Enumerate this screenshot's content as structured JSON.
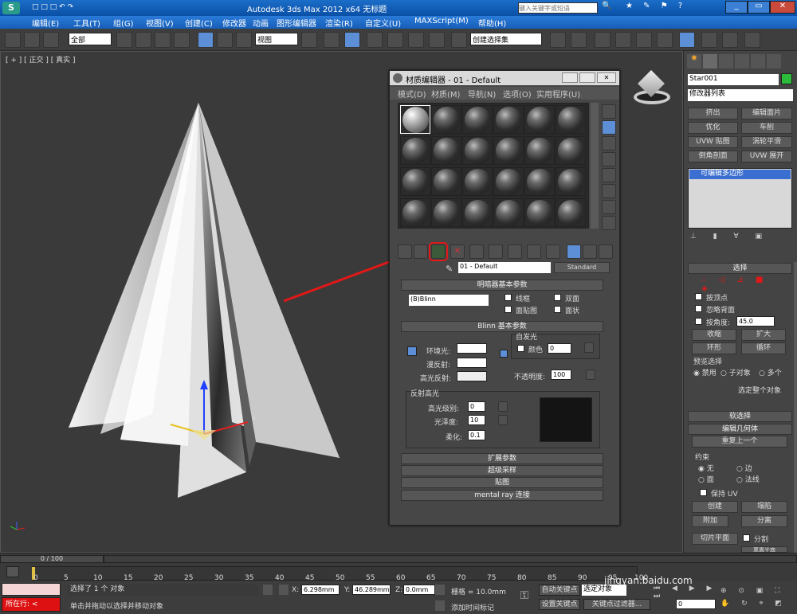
{
  "window": {
    "title": "Autodesk 3ds Max  2012 x64    无标题",
    "search_placeholder": "键入关键字或短语"
  },
  "menu": [
    "编辑(E)",
    "工具(T)",
    "组(G)",
    "视图(V)",
    "创建(C)",
    "修改器",
    "动画",
    "图形编辑器",
    "渲染(R)",
    "自定义(U)",
    "MAXScript(M)",
    "帮助(H)"
  ],
  "toolbar": {
    "selection_filter": "全部",
    "coord_system": "视图",
    "named_selection": "创建选择集"
  },
  "viewport": {
    "label": "[ + ] [ 正交 ] [ 真实 ]"
  },
  "material_editor": {
    "title": "材质编辑器 - 01 - Default",
    "menu": [
      "模式(D)",
      "材质(M)",
      "导航(N)",
      "选项(O)",
      "实用程序(U)"
    ],
    "material_name": "01 - Default",
    "material_type": "Standard",
    "shader_rollout": {
      "title": "明暗器基本参数",
      "shader": "(B)Blinn",
      "wire": "线框",
      "two_sided": "双面",
      "face_map": "面贴图",
      "faceted": "面状"
    },
    "blinn_rollout": {
      "title": "Blinn 基本参数",
      "ambient": "环境光:",
      "diffuse": "漫反射:",
      "specular": "高光反射:",
      "self_illum": "自发光",
      "color": "颜色",
      "self_illum_val": "0",
      "opacity": "不透明度:",
      "opacity_val": "100"
    },
    "spec_hl": {
      "title": "反射高光",
      "level": "高光级别:",
      "level_val": "0",
      "gloss": "光泽度:",
      "gloss_val": "10",
      "soften": "柔化:",
      "soften_val": "0.1"
    },
    "rollouts": [
      "扩展参数",
      "超级采样",
      "贴图",
      "mental ray 连接"
    ]
  },
  "command_panel": {
    "object_name": "Star001",
    "modifier_list": "修改器列表",
    "buttons": [
      "挤出",
      "编辑面片",
      "优化",
      "车削",
      "UVW 贴图",
      "涡轮平滑",
      "倒角剖面",
      "UVW 展开"
    ],
    "stack_item": "可编辑多边形",
    "selection": {
      "title": "选择",
      "by_vertex": "按顶点",
      "ignore_backface": "忽略背面",
      "by_angle": "按角度:",
      "angle_val": "45.0",
      "shrink": "收缩",
      "grow": "扩大",
      "ring": "环形",
      "loop": "循环",
      "preview": "预览选择",
      "disabled": "禁用",
      "subobject": "子对象",
      "multi": "多个",
      "selected": "选定整个对象"
    },
    "soft_selection": "软选择",
    "edit_geometry": "编辑几何体",
    "repeat_last": "重复上一个",
    "constraints": {
      "title": "约束",
      "none": "无",
      "edge": "边",
      "face": "面",
      "normal": "法线"
    },
    "preserve_uv": "保持 UV",
    "create": "创建",
    "collapse": "塌陷",
    "attach": "附加",
    "detach": "分离",
    "slice_plane": "切片平面",
    "split": "分割",
    "reset_plane": "重置平面",
    "quickslice": "快速切片",
    "cut": "切割"
  },
  "timeline": {
    "frame": "0 / 100",
    "ticks": [
      "0",
      "5",
      "10",
      "15",
      "20",
      "25",
      "30",
      "35",
      "40",
      "45",
      "50",
      "55",
      "60",
      "65",
      "70",
      "75",
      "80",
      "85",
      "90",
      "95",
      "100"
    ]
  },
  "status": {
    "selected": "选择了 1 个 对象",
    "prompt": "单击并拖动以选择并移动对象",
    "x_label": "X:",
    "x": "6.298mm",
    "y_label": "Y:",
    "y": "46.289mm",
    "z_label": "Z:",
    "z": "0.0mm",
    "grid": "栅格 = 10.0mm",
    "auto_key": "自动关键点",
    "set_key": "设置关键点",
    "selected_obj": "选定对象",
    "key_filter": "关键点过滤器...",
    "add_tag": "添加时间标记",
    "running": "所在行:",
    "frame_input": "0",
    "watermark": "jingyan.baidu.com"
  }
}
